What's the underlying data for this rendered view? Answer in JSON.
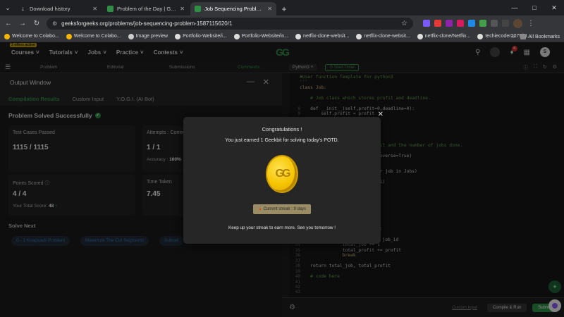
{
  "browser": {
    "tabs": [
      {
        "label": "Download history",
        "icon": "download-icon"
      },
      {
        "label": "Problem of the Day | GeeksforG",
        "icon": "gfg-favicon"
      },
      {
        "label": "Job Sequencing Problem | Pract",
        "icon": "gfg-favicon",
        "active": true
      }
    ],
    "url": "geeksforgeeks.org/problems/job-sequencing-problem-1587115620/1",
    "notif_count": "4",
    "bookmarks": [
      "Welcome to Colabo...",
      "Welcome to Colabo...",
      "Image preview",
      "Portfolio-Website/i...",
      "Portfolio-Website/in...",
      "netflix-clone-websit...",
      "netflix-clone-websit...",
      "netflix-clone/Netflix...",
      "techiecoder2079/N..."
    ],
    "all_bookmarks": "All Bookmarks"
  },
  "site": {
    "badge_new": "3 offers active",
    "menu": [
      "Courses",
      "Tutorials",
      "Jobs",
      "Practice",
      "Contests"
    ],
    "logo": "GG",
    "avatar_letter": "S",
    "problem_tabs": [
      "Problem",
      "Editorial",
      "Submissions",
      "Comments"
    ]
  },
  "output": {
    "title": "Output Window",
    "result_tabs": [
      "Compilation Results",
      "Custom Input",
      "Y.O.G.I. (AI Bot)"
    ],
    "solved": "Problem Solved Successfully",
    "cards": {
      "tests_label": "Test Cases Passed",
      "tests_value": "1115 / 1115",
      "attempts_label": "Attempts : Correct",
      "attempts_value": "1 / 1",
      "accuracy_label": "Accuracy :",
      "accuracy_value": "100%",
      "points_label": "Points Scored",
      "points_value": "4 / 4",
      "total_label": "Your Total Score:",
      "total_value": "48",
      "time_label": "Time Taken",
      "time_value": "7.45"
    },
    "solve_next": "Solve Next",
    "next_chips": [
      "0 - 1 Knapsack Problem",
      "Maximize The Cut Segments",
      "Subset"
    ]
  },
  "editor": {
    "language": "Python3",
    "timer": "Start Timer",
    "custom_input": "Custom Input",
    "compile": "Compile & Run",
    "submit": "Submit",
    "lines": [
      {
        "n": "",
        "t": "#User function Template for python3",
        "c": "cmt"
      },
      {
        "n": "",
        "t": "'''",
        "c": "cmt"
      },
      {
        "n": "",
        "t": "class Job:",
        "c": "kw"
      },
      {
        "n": "",
        "t": "",
        "c": ""
      },
      {
        "n": "",
        "t": "    # Job class which stores profit and deadline.",
        "c": "cmt"
      },
      {
        "n": "",
        "t": "",
        "c": ""
      },
      {
        "n": "",
        "t": "    def __init__(self,profit=0,deadline=0):",
        "c": ""
      },
      {
        "n": "",
        "t": "        self.profit = profit",
        "c": ""
      },
      {
        "n": "",
        "t": "",
        "c": ""
      },
      {
        "n": "",
        "t": "",
        "c": ""
      },
      {
        "n": "",
        "t": "",
        "c": ""
      },
      {
        "n": "",
        "t": "",
        "c": ""
      },
      {
        "n": "",
        "t": "",
        "c": ""
      },
      {
        "n": "",
        "t": "                          profit and the number of jobs done.",
        "c": "cmt"
      },
      {
        "n": "",
        "t": "                   ):",
        "c": ""
      },
      {
        "n": "",
        "t": "                   x.profit, reverse=True)",
        "c": ""
      },
      {
        "n": "",
        "t": "",
        "c": ""
      },
      {
        "n": "",
        "t": "",
        "c": ""
      },
      {
        "n": "",
        "t": "                   deadline for job in Jobs)",
        "c": ""
      },
      {
        "n": "",
        "t": "",
        "c": ""
      },
      {
        "n": "",
        "t": "                   deadline + 1)",
        "c": ""
      },
      {
        "n": "",
        "t": "",
        "c": ""
      },
      {
        "n": "",
        "t": "",
        "c": ""
      },
      {
        "n": "",
        "t": "",
        "c": ""
      },
      {
        "n": "",
        "t": "",
        "c": ""
      },
      {
        "n": "",
        "t": "",
        "c": ""
      },
      {
        "n": "",
        "t": "                   line",
        "c": ""
      },
      {
        "n": "",
        "t": "",
        "c": ""
      },
      {
        "n": "",
        "t": "",
        "c": ""
      },
      {
        "n": "",
        "t": "                   ime, 0, -1):",
        "c": ""
      },
      {
        "n": "",
        "t": "                   is None:",
        "c": ""
      },
      {
        "n": "33",
        "t": "                time_slot[i] = job_id",
        "c": ""
      },
      {
        "n": "34",
        "t": "                total_job += 1",
        "c": ""
      },
      {
        "n": "35",
        "t": "                total_profit += profit",
        "c": ""
      },
      {
        "n": "36",
        "t": "                break",
        "c": "kw"
      },
      {
        "n": "37",
        "t": "",
        "c": ""
      },
      {
        "n": "38",
        "t": "    return total_job, total_profit",
        "c": ""
      },
      {
        "n": "39",
        "t": "",
        "c": ""
      },
      {
        "n": "40",
        "t": "    # code here",
        "c": "cmt"
      },
      {
        "n": "41",
        "t": "",
        "c": ""
      },
      {
        "n": "42",
        "t": "",
        "c": ""
      },
      {
        "n": "43",
        "t": "",
        "c": ""
      }
    ],
    "gutter_top": [
      "8",
      "9",
      "10"
    ]
  },
  "modal": {
    "title": "Congratulations !",
    "message": "You just earned 1 Geekbit for solving today's POTD.",
    "streak": "Current streak : 9 days",
    "footer": "Keep up your streak to earn more. See you tomorrow !"
  }
}
